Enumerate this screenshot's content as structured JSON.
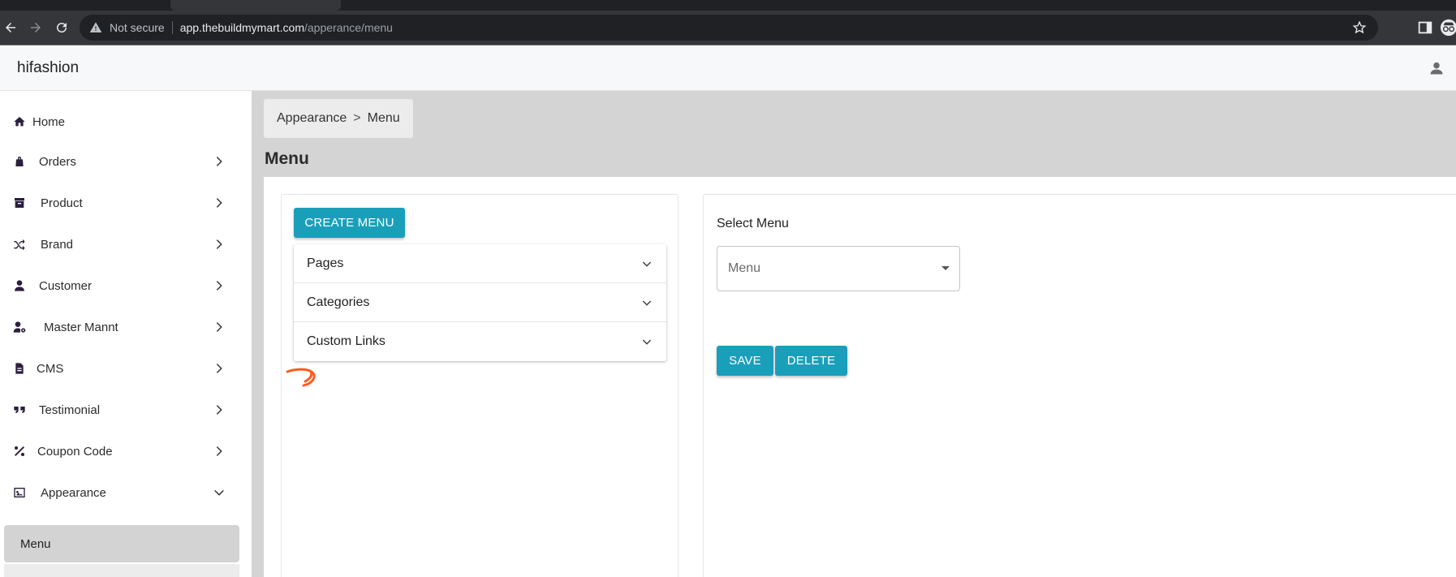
{
  "browser": {
    "secure_label": "Not secure",
    "url_host": "app.thebuildmymart.com",
    "url_path": "/apperance/menu"
  },
  "app": {
    "brand": "hifashion"
  },
  "sidebar": {
    "items": [
      {
        "label": "Home",
        "icon": "home-icon"
      },
      {
        "label": "Orders",
        "icon": "shopping-bag-icon"
      },
      {
        "label": "Product",
        "icon": "archive-box-icon"
      },
      {
        "label": "Brand",
        "icon": "shuffle-icon"
      },
      {
        "label": "Customer",
        "icon": "person-icon"
      },
      {
        "label": "Master Mannt",
        "icon": "user-gear-icon"
      },
      {
        "label": "CMS",
        "icon": "document-icon"
      },
      {
        "label": "Testimonial",
        "icon": "quote-icon"
      },
      {
        "label": "Coupon Code",
        "icon": "percent-icon"
      },
      {
        "label": "Appearance",
        "icon": "image-icon"
      }
    ],
    "sub_items": [
      {
        "label": "Menu",
        "active": true
      }
    ]
  },
  "main": {
    "breadcrumb": {
      "parent": "Appearance",
      "separator": ">",
      "current": "Menu"
    },
    "page_title": "Menu",
    "left_panel": {
      "create_button": "CREATE MENU",
      "accordion": [
        {
          "label": "Pages"
        },
        {
          "label": "Categories"
        },
        {
          "label": "Custom Links"
        }
      ]
    },
    "right_panel": {
      "select_label": "Select Menu",
      "select_placeholder": "Menu",
      "save_button": "SAVE",
      "delete_button": "DELETE"
    }
  },
  "colors": {
    "accent": "#1a9fba",
    "sidebar_icon": "#2a1f3d",
    "main_bg": "#d4d4d4",
    "annotation": "#ff5a1f"
  }
}
